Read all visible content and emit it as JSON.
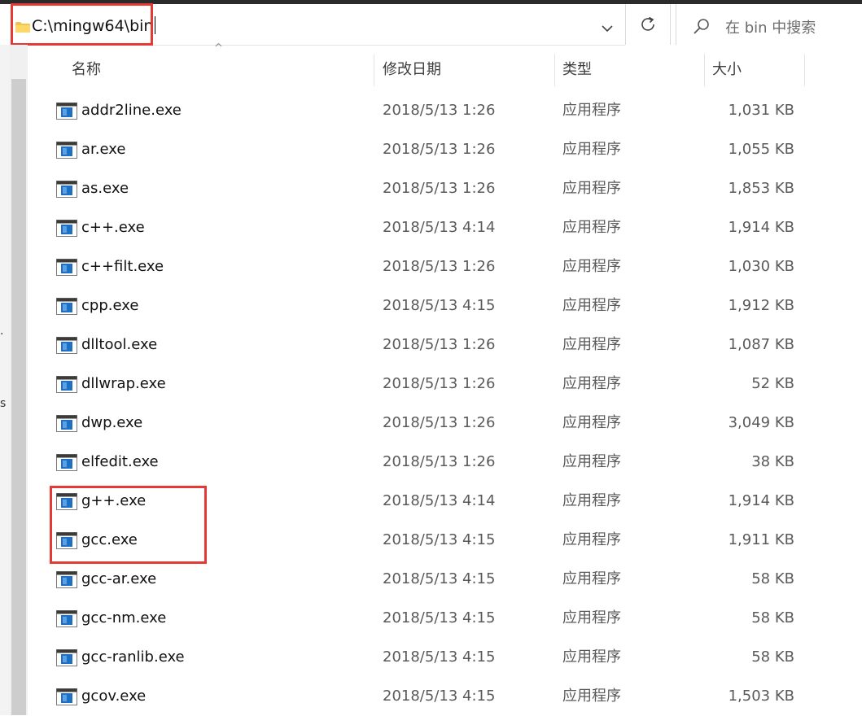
{
  "address": {
    "path": "C:\\mingw64\\bin",
    "folder_icon": "folder-icon"
  },
  "search": {
    "placeholder": "在 bin 中搜索"
  },
  "columns": {
    "name": "名称",
    "date": "修改日期",
    "type": "类型",
    "size": "大小"
  },
  "files": [
    {
      "name": "addr2line.exe",
      "date": "2018/5/13 1:26",
      "type": "应用程序",
      "size": "1,031 KB"
    },
    {
      "name": "ar.exe",
      "date": "2018/5/13 1:26",
      "type": "应用程序",
      "size": "1,055 KB"
    },
    {
      "name": "as.exe",
      "date": "2018/5/13 1:26",
      "type": "应用程序",
      "size": "1,853 KB"
    },
    {
      "name": "c++.exe",
      "date": "2018/5/13 4:14",
      "type": "应用程序",
      "size": "1,914 KB"
    },
    {
      "name": "c++filt.exe",
      "date": "2018/5/13 1:26",
      "type": "应用程序",
      "size": "1,030 KB"
    },
    {
      "name": "cpp.exe",
      "date": "2018/5/13 4:15",
      "type": "应用程序",
      "size": "1,912 KB"
    },
    {
      "name": "dlltool.exe",
      "date": "2018/5/13 1:26",
      "type": "应用程序",
      "size": "1,087 KB"
    },
    {
      "name": "dllwrap.exe",
      "date": "2018/5/13 1:26",
      "type": "应用程序",
      "size": "52 KB"
    },
    {
      "name": "dwp.exe",
      "date": "2018/5/13 1:26",
      "type": "应用程序",
      "size": "3,049 KB"
    },
    {
      "name": "elfedit.exe",
      "date": "2018/5/13 1:26",
      "type": "应用程序",
      "size": "38 KB"
    },
    {
      "name": "g++.exe",
      "date": "2018/5/13 4:14",
      "type": "应用程序",
      "size": "1,914 KB"
    },
    {
      "name": "gcc.exe",
      "date": "2018/5/13 4:15",
      "type": "应用程序",
      "size": "1,911 KB"
    },
    {
      "name": "gcc-ar.exe",
      "date": "2018/5/13 4:15",
      "type": "应用程序",
      "size": "58 KB"
    },
    {
      "name": "gcc-nm.exe",
      "date": "2018/5/13 4:15",
      "type": "应用程序",
      "size": "58 KB"
    },
    {
      "name": "gcc-ranlib.exe",
      "date": "2018/5/13 4:15",
      "type": "应用程序",
      "size": "58 KB"
    },
    {
      "name": "gcov.exe",
      "date": "2018/5/13 4:15",
      "type": "应用程序",
      "size": "1,503 KB"
    }
  ],
  "colors": {
    "annotation_red": "#e53935",
    "folder_yellow": "#f3c44d",
    "exe_blue": "#1f6fc5"
  }
}
